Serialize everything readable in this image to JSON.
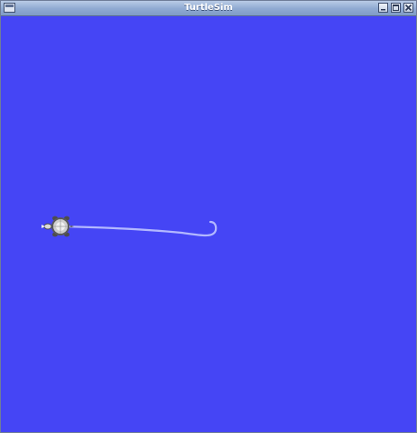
{
  "window": {
    "title": "TurtleSim"
  },
  "icons": {
    "menu": "window-menu-icon",
    "minimize": "minimize-icon",
    "maximize": "maximize-icon",
    "close": "close-icon",
    "turtle": "turtle-icon"
  },
  "colors": {
    "background": "#4545f5",
    "pen": "#b3b8ff",
    "titlebar": "#8fa9d1"
  }
}
